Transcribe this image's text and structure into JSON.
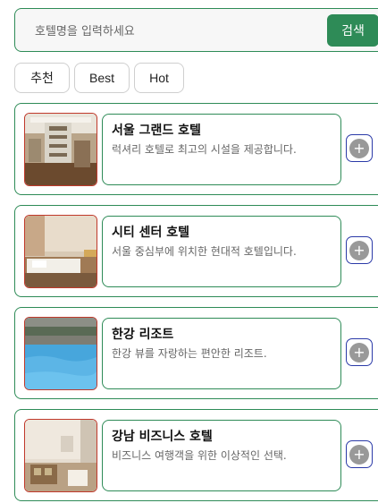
{
  "search": {
    "placeholder": "호텔명을 입력하세요",
    "value": "",
    "button_label": "검색"
  },
  "tabs": [
    {
      "label": "추천"
    },
    {
      "label": "Best"
    },
    {
      "label": "Hot"
    }
  ],
  "hotels": [
    {
      "name": "서울 그랜드 호텔",
      "description": "럭셔리 호텔로 최고의 시설을 제공합니다.",
      "image": "hotel-lobby-photo"
    },
    {
      "name": "시티 센터 호텔",
      "description": "서울 중심부에 위치한 현대적 호텔입니다.",
      "image": "hotel-room-photo"
    },
    {
      "name": "한강 리조트",
      "description": "한강 뷰를 자랑하는 편안한 리조트.",
      "image": "resort-pool-photo"
    },
    {
      "name": "강남 비즈니스 호텔",
      "description": "비즈니스 여행객을 위한 이상적인 선택.",
      "image": "business-room-photo"
    }
  ],
  "add_button_icon": "plus-icon",
  "colors": {
    "accent": "#2e8b57",
    "thumb_border": "#c0392b",
    "add_border": "#2b3aa8"
  }
}
